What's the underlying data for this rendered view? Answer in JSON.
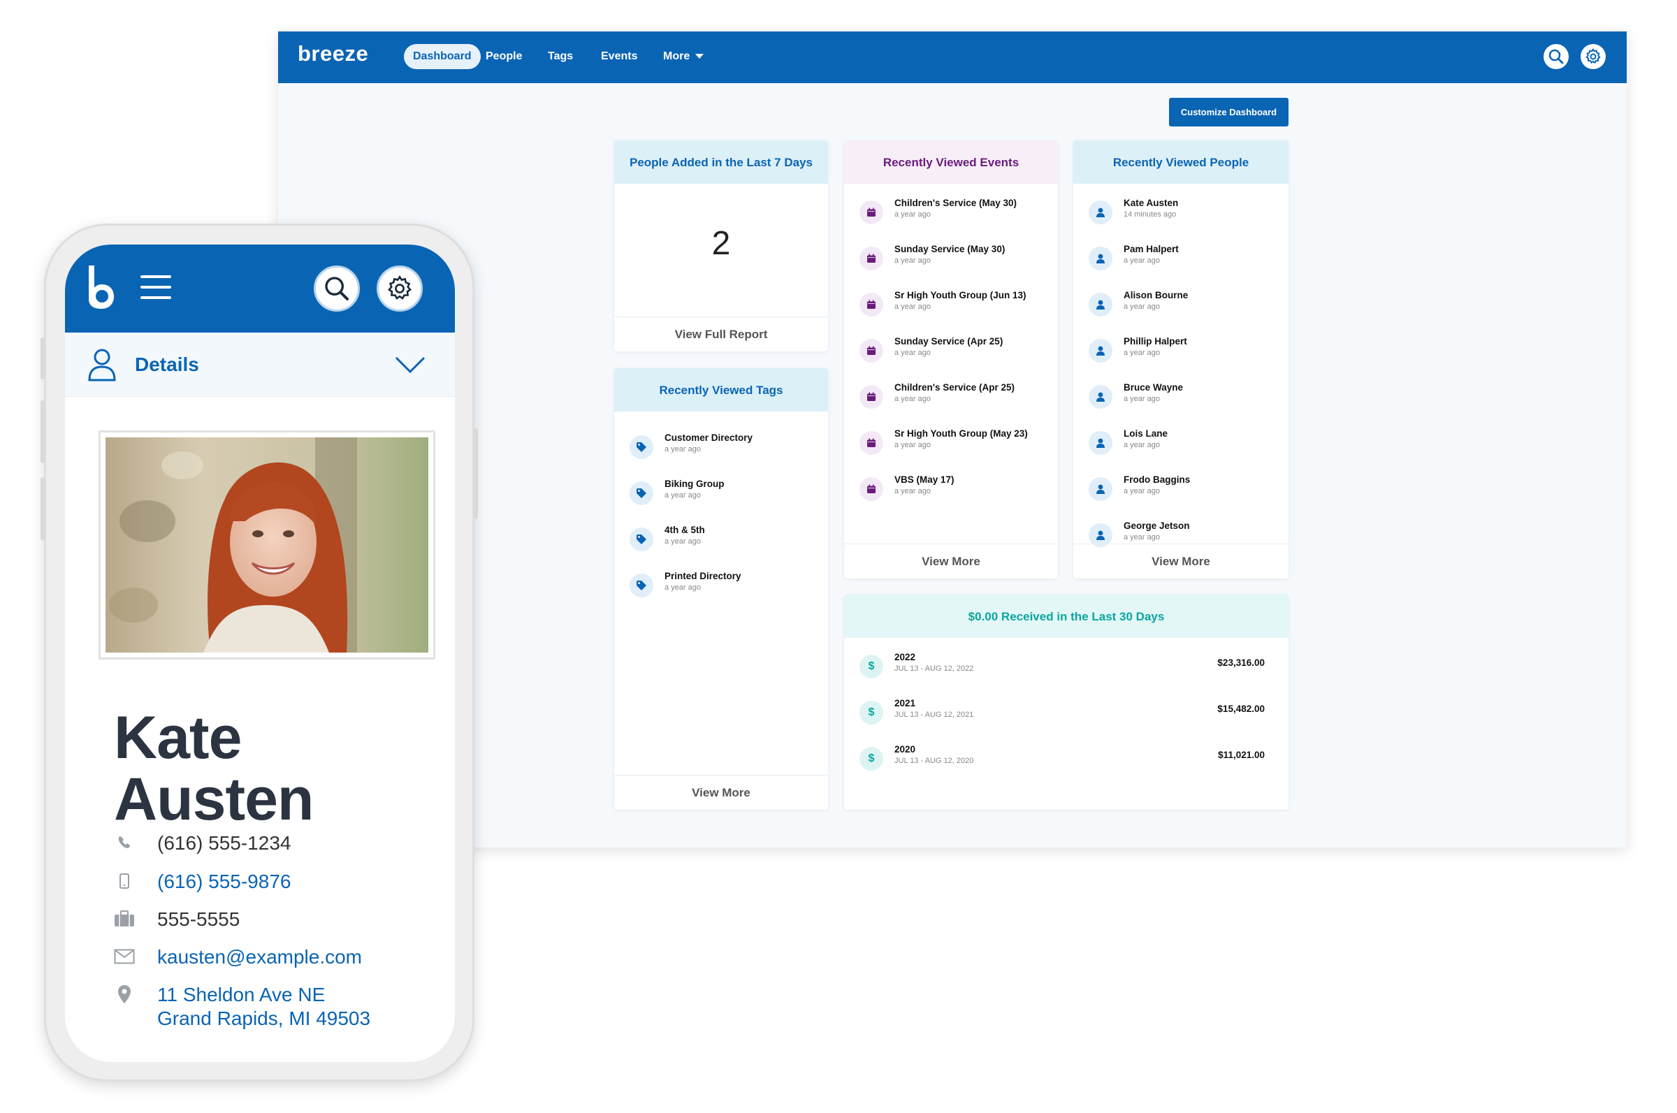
{
  "desktop": {
    "logo": "breeze",
    "nav": [
      {
        "label": "Dashboard",
        "active": true
      },
      {
        "label": "People"
      },
      {
        "label": "Tags"
      },
      {
        "label": "Events"
      },
      {
        "label": "More"
      }
    ],
    "customize_button": "Customize Dashboard",
    "people_added": {
      "title": "People Added in the Last 7 Days",
      "count": "2",
      "footer": "View Full Report"
    },
    "recent_tags": {
      "title": "Recently Viewed Tags",
      "items": [
        {
          "name": "Customer Directory",
          "time": "a year ago"
        },
        {
          "name": "Biking Group",
          "time": "a year ago"
        },
        {
          "name": "4th & 5th",
          "time": "a year ago"
        },
        {
          "name": "Printed Directory",
          "time": "a year ago"
        }
      ],
      "footer": "View More"
    },
    "recent_events": {
      "title": "Recently Viewed Events",
      "items": [
        {
          "name": "Children's Service (May 30)",
          "time": "a year ago"
        },
        {
          "name": "Sunday Service (May 30)",
          "time": "a year ago"
        },
        {
          "name": "Sr High Youth Group (Jun 13)",
          "time": "a year ago"
        },
        {
          "name": "Sunday Service (Apr 25)",
          "time": "a year ago"
        },
        {
          "name": "Children's Service (Apr 25)",
          "time": "a year ago"
        },
        {
          "name": "Sr High Youth Group (May 23)",
          "time": "a year ago"
        },
        {
          "name": "VBS (May 17)",
          "time": "a year ago"
        }
      ],
      "footer": "View More"
    },
    "recent_people": {
      "title": "Recently Viewed People",
      "items": [
        {
          "name": "Kate Austen",
          "time": "14 minutes ago"
        },
        {
          "name": "Pam Halpert",
          "time": "a year ago"
        },
        {
          "name": "Alison Bourne",
          "time": "a year ago"
        },
        {
          "name": "Phillip Halpert",
          "time": "a year ago"
        },
        {
          "name": "Bruce Wayne",
          "time": "a year ago"
        },
        {
          "name": "Lois Lane",
          "time": "a year ago"
        },
        {
          "name": "Frodo Baggins",
          "time": "a year ago"
        },
        {
          "name": "George Jetson",
          "time": "a year ago"
        }
      ],
      "footer": "View More"
    },
    "giving": {
      "title": "$0.00 Received in the Last 30 Days",
      "items": [
        {
          "year": "2022",
          "range": "JUL 13 - AUG 12, 2022",
          "amount": "$23,316.00"
        },
        {
          "year": "2021",
          "range": "JUL 13 - AUG 12, 2021",
          "amount": "$15,482.00"
        },
        {
          "year": "2020",
          "range": "JUL 13 - AUG 12, 2020",
          "amount": "$11,021.00"
        }
      ]
    },
    "colors": {
      "brand_blue": "#0a64b4",
      "event_purple": "#6a1b7c",
      "giving_teal": "#0aa6a0"
    }
  },
  "phone": {
    "section_label": "Details",
    "person": {
      "first_name": "Kate",
      "last_name": "Austen",
      "home_phone": "(616) 555-1234",
      "mobile_phone": "(616) 555-9876",
      "work_phone": "555-5555",
      "email": "kausten@example.com",
      "address_line1": "11 Sheldon Ave NE",
      "address_line2": "Grand Rapids, MI 49503"
    },
    "icons": [
      "b-logo-icon",
      "menu-icon",
      "search-icon",
      "gear-icon",
      "user-icon",
      "chevron-down-icon",
      "phone-icon",
      "mobile-icon",
      "briefcase-icon",
      "mail-icon",
      "location-pin-icon"
    ]
  }
}
